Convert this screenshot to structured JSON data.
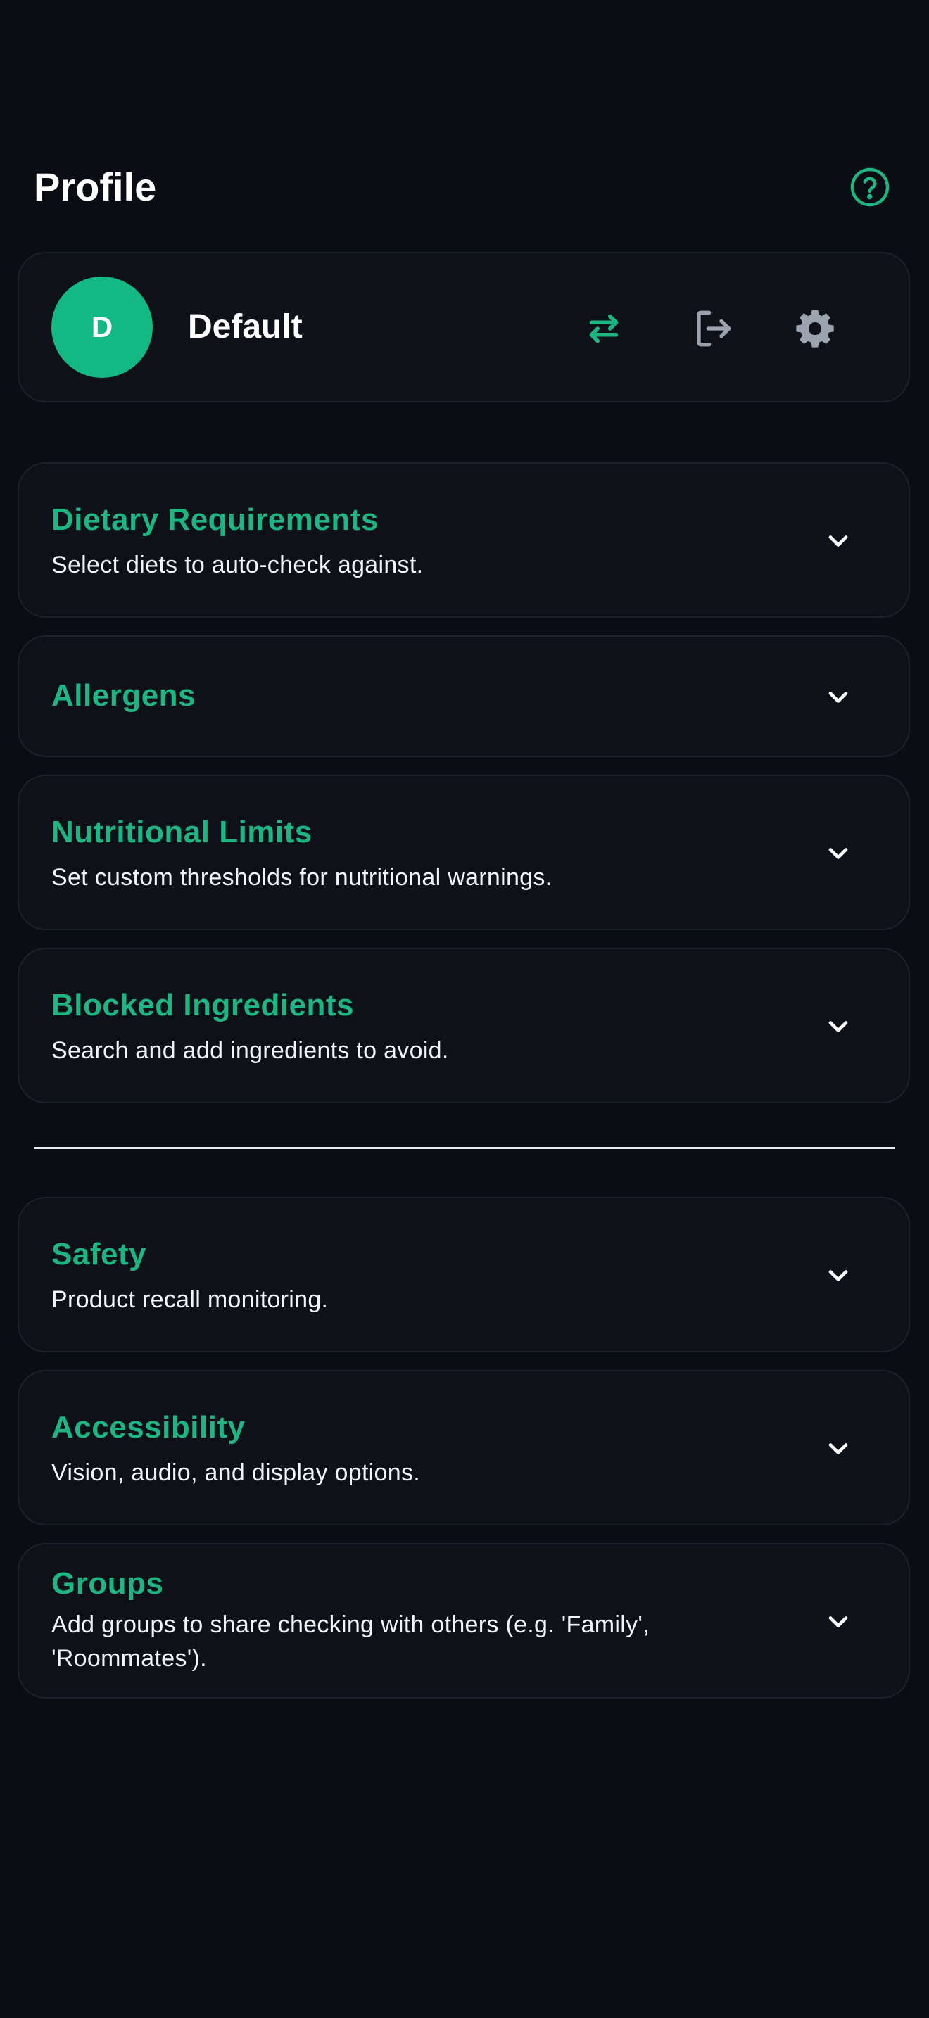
{
  "header": {
    "title": "Profile",
    "help_icon": "help-circle-icon"
  },
  "profile": {
    "avatar_letter": "D",
    "name": "Default",
    "switch_icon": "switch-profile-icon",
    "logout_icon": "logout-icon",
    "settings_icon": "gear-icon"
  },
  "sections": [
    {
      "title": "Dietary Requirements",
      "subtitle": "Select diets to auto-check against."
    },
    {
      "title": "Allergens",
      "subtitle": ""
    },
    {
      "title": "Nutritional Limits",
      "subtitle": "Set custom thresholds for nutritional warnings."
    },
    {
      "title": "Blocked Ingredients",
      "subtitle": "Search and add ingredients to avoid."
    },
    {
      "title": "Safety",
      "subtitle": "Product recall monitoring."
    },
    {
      "title": "Accessibility",
      "subtitle": "Vision, audio, and display options."
    },
    {
      "title": "Groups",
      "subtitle": "Add groups to share checking with others (e.g. 'Family', 'Roommates')."
    }
  ],
  "colors": {
    "accent": "#14b883",
    "background": "#0a0d13",
    "card": "#0e1218",
    "icon_muted": "#9aa3ae"
  }
}
